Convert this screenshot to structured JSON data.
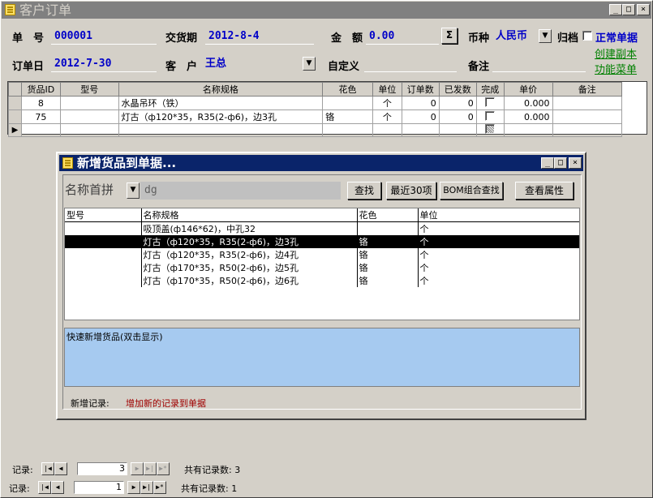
{
  "window": {
    "title": "客户订单",
    "controls": [
      "_",
      "□",
      "×"
    ]
  },
  "header": {
    "order_no_label": "单　号",
    "order_no": "000001",
    "delivery_label": "交货期",
    "delivery": "2012-8-4",
    "amount_label": "金　额",
    "amount": "0.00",
    "sum_button": "Σ",
    "currency_label": "币种",
    "currency": "人民币",
    "archive_label": "归档",
    "normal_label": "正常单据",
    "order_date_label": "订单日",
    "order_date": "2012-7-30",
    "customer_label": "客　户",
    "customer": "王总",
    "custom_label": "自定义",
    "custom": "",
    "remark_label": "备注",
    "remark": "",
    "link_copy": "创建副本",
    "link_menu": "功能菜单"
  },
  "grid": {
    "columns": [
      "货品ID",
      "型号",
      "名称规格",
      "花色",
      "单位",
      "订单数",
      "已发数",
      "完成",
      "单价",
      "备注"
    ],
    "rows": [
      {
        "id": "8",
        "model": "",
        "name": "水晶吊环（铁）",
        "color": "",
        "unit": "个",
        "qty": "0",
        "shipped": "0",
        "done": false,
        "price": "0.000",
        "note": ""
      },
      {
        "id": "75",
        "model": "",
        "name": "灯古（ф120*35，R35(2-ф6)，边3孔",
        "color": "铬",
        "unit": "个",
        "qty": "0",
        "shipped": "0",
        "done": false,
        "price": "0.000",
        "note": ""
      }
    ],
    "new_row_marker": "▶"
  },
  "dialog": {
    "title": "新增货品到单据...",
    "search_mode": "名称首拼",
    "search_value": "dg",
    "btn_find": "查找",
    "btn_recent": "最近30项",
    "btn_bom": "BOM组合查找",
    "btn_props": "查看属性",
    "columns": [
      "型号",
      "名称规格",
      "花色",
      "单位"
    ],
    "results": [
      {
        "model": "",
        "name": "吸顶盖(ф146*62)，中孔32",
        "color": "",
        "unit": "个",
        "selected": false
      },
      {
        "model": "",
        "name": "灯古（ф120*35，R35(2-ф6)，边3孔",
        "color": "铬",
        "unit": "个",
        "selected": true
      },
      {
        "model": "",
        "name": "灯古（ф120*35，R35(2-ф6)，边4孔",
        "color": "铬",
        "unit": "个",
        "selected": false
      },
      {
        "model": "",
        "name": "灯古（ф170*35，R50(2-ф6)，边5孔",
        "color": "铬",
        "unit": "个",
        "selected": false
      },
      {
        "model": "",
        "name": "灯古（ф170*35，R50(2-ф6)，边6孔",
        "color": "铬",
        "unit": "个",
        "selected": false
      }
    ],
    "quick_add_label": "快速新增货品(双击显示)",
    "new_record_label": "新增记录:",
    "new_record_action": "增加新的记录到单据"
  },
  "nav_sub": {
    "label": "记录:",
    "current": "3",
    "total_label": "共有记录数: 3"
  },
  "nav_main": {
    "label": "记录:",
    "current": "1",
    "total_label": "共有记录数: 1"
  }
}
